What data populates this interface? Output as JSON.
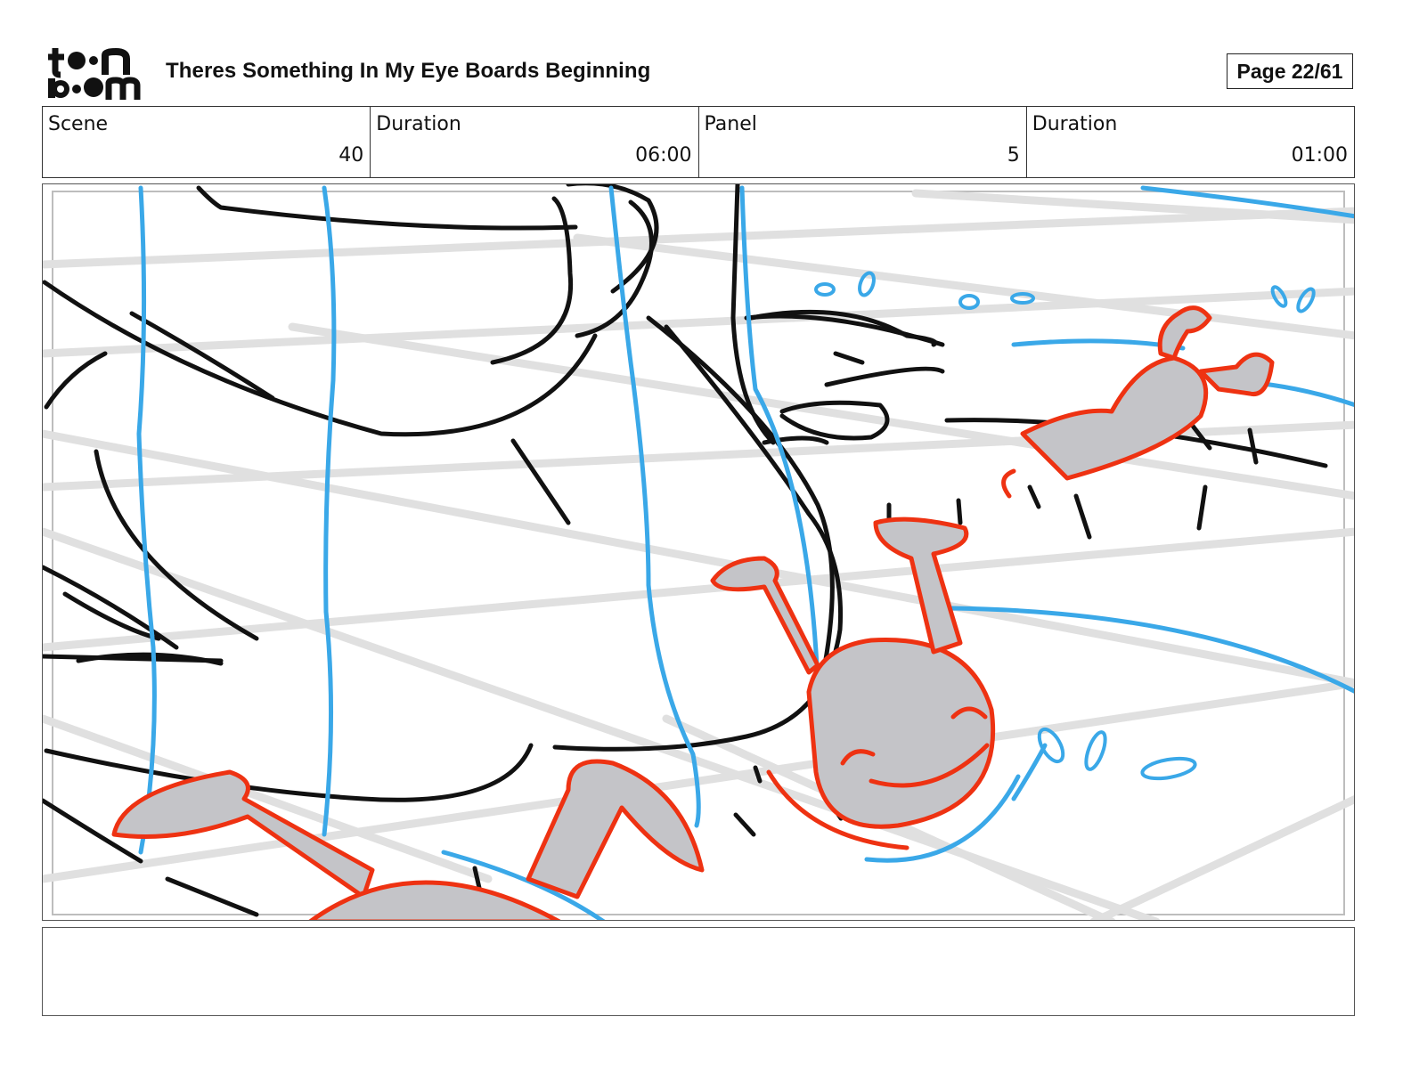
{
  "header": {
    "logo_text_top": "toon",
    "logo_text_bottom": "boom",
    "title": "Theres Something In My Eye Boards Beginning",
    "page_label": "Page 22/61"
  },
  "info": {
    "scene_label": "Scene",
    "scene_value": "40",
    "scene_duration_label": "Duration",
    "scene_duration_value": "06:00",
    "panel_label": "Panel",
    "panel_value": "5",
    "panel_duration_label": "Duration",
    "panel_duration_value": "01:00"
  },
  "notes": {
    "text": ""
  },
  "colors": {
    "ink": "#111111",
    "blue": "#3aa8e8",
    "red": "#ee3212",
    "gray_fill": "#c4c4c8",
    "grid": "#e0e0e0"
  }
}
